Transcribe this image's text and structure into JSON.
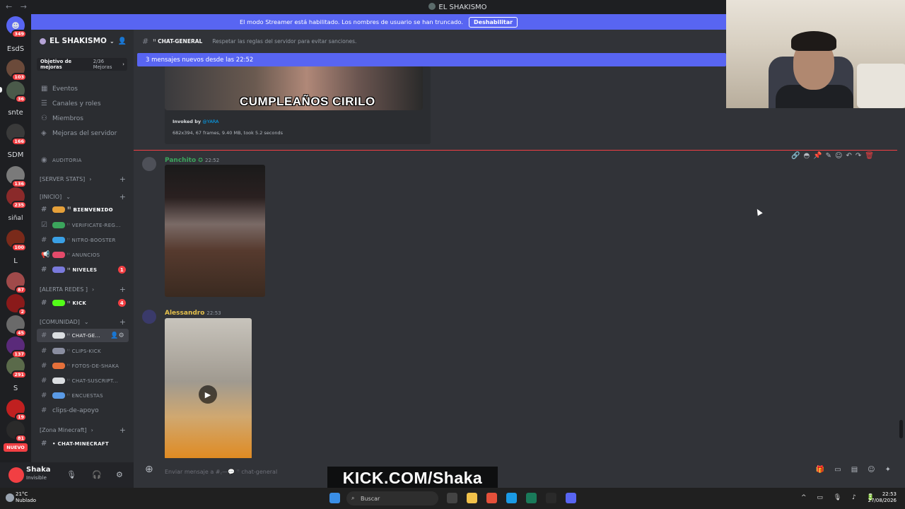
{
  "window": {
    "nav": "← →",
    "title": "EL SHAKISMO"
  },
  "banner": {
    "text": "El modo Streamer está habilitado. Los nombres de usuario se han truncado.",
    "button": "Deshabilitar"
  },
  "rail": {
    "servers": [
      {
        "label": "",
        "badge": "349"
      },
      {
        "label": "EsdS",
        "badge": ""
      },
      {
        "label": "",
        "badge": "103"
      },
      {
        "label": "",
        "badge": "36"
      },
      {
        "label": "snte",
        "badge": ""
      },
      {
        "label": "",
        "badge": "166"
      },
      {
        "label": "SDM",
        "badge": ""
      },
      {
        "label": "",
        "badge": "136"
      },
      {
        "label": "",
        "badge": "235"
      },
      {
        "label": "siñal",
        "badge": ""
      },
      {
        "label": "",
        "badge": "100"
      },
      {
        "label": "L",
        "badge": ""
      },
      {
        "label": "",
        "badge": "87"
      },
      {
        "label": "",
        "badge": "2"
      },
      {
        "label": "",
        "badge": "45"
      },
      {
        "label": "",
        "badge": "137"
      },
      {
        "label": "",
        "badge": "291"
      },
      {
        "label": "S",
        "badge": ""
      },
      {
        "label": "",
        "badge": "19"
      },
      {
        "label": "",
        "badge": "81"
      }
    ],
    "new_label": "NUEVO"
  },
  "sidebar": {
    "server_name": "EL SHAKISMO",
    "boost_goal": "Objetivo de mejoras",
    "boost_count": "2/36 Mejoras",
    "menu": [
      "Eventos",
      "Canales y roles",
      "Miembros",
      "Mejoras del servidor"
    ],
    "audit": "Auditoria",
    "categories": {
      "server_stats": "[SERVER STATS]",
      "inicio": "[INICIO]",
      "alerta": "[ALERTA REDES ]",
      "comunidad": "[COMUNIDAD]",
      "minecraft": "[Zona Minecraft]"
    },
    "channels": {
      "bienvenido": "ꜝꜝ ʙɪᴇɴᴠᴇɴɪᴅᴏ",
      "verificate": "ꜝꜝ verificate-reg...",
      "nitro": "ꜝꜝ nitro-booster",
      "anuncios": "ꜝꜝ anuncios",
      "niveles": "ꜝꜝ niveles",
      "niveles_count": "1",
      "kick": "ꜝꜝ kick",
      "kick_count": "4",
      "chat_general": "ꜝꜝ chat-ge...",
      "clips_kick": "ꜝꜝ clips-kick",
      "fotos": "ꜝꜝ fotos-de-shaka",
      "chat_suscript": "ꜝꜝ chat-suscript...",
      "encuestas": "ꜝꜝ encuestas",
      "clips_apoyo": "clips-de-apoyo",
      "chat_minecraft": "• chat-minecraft"
    }
  },
  "user": {
    "name": "Shaka",
    "status": "Invisible"
  },
  "main": {
    "channel_name": "ꜝꜝ chat-general",
    "topic": "Respetar las reglas del servidor para evitar sanciones.",
    "new_messages": "3 mensajes nuevos desde las 22:52",
    "embed": {
      "caption": "CUMPLEAÑOS CIRILO",
      "invoked_prefix": "Invoked by",
      "invoked_user": "@YARA",
      "meta": "682x394, 67 frames, 9.40 MB, took 5.2 seconds"
    },
    "messages": [
      {
        "author": "Panchito",
        "time": "22:52",
        "color": "#3ba55c"
      },
      {
        "author": "Alessandro",
        "time": "22:53",
        "color": "#e5c04b"
      }
    ],
    "composer_placeholder": "Enviar mensaje a #꜀—💬 ꜝꜝ chat-general"
  },
  "watermark": "KICK.COM/Shaka",
  "taskbar": {
    "temp": "21°C",
    "weather": "Nublado",
    "search": "Buscar",
    "time": "22:53",
    "date": "27/08/2026"
  },
  "colors": {
    "blurple": "#5865f2",
    "red": "#f23f43",
    "green": "#3ba55c",
    "yellow": "#e5c04b"
  }
}
